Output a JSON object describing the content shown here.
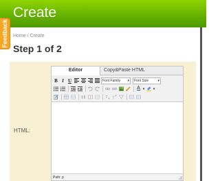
{
  "header": {
    "title": "Create",
    "color": "#66b300"
  },
  "feedback": {
    "label": "Feedback",
    "color": "#f5a623"
  },
  "breadcrumb": {
    "home": "Home",
    "separator": "/",
    "current": "Create"
  },
  "page_title": "Step 1 of 2",
  "form": {
    "html_label": "HTML:"
  },
  "editor": {
    "tabs": [
      {
        "label": "Editor",
        "active": true
      },
      {
        "label": "Copy&Paste HTML",
        "active": false
      }
    ],
    "toolbar": {
      "row1": {
        "bold": "B",
        "italic": "I",
        "underline": "U",
        "font_family": "Font Family",
        "font_size": "Font Size"
      },
      "row2_icons": [
        "bullet-list-icon",
        "numbered-list-icon",
        "outdent-icon",
        "indent-icon",
        "undo-icon",
        "redo-icon",
        "link-icon",
        "unlink-icon",
        "image-icon",
        "cleanup-icon",
        "text-color-icon",
        "highlight-color-icon"
      ],
      "row3_icons": [
        "edit-icon",
        "table-icon",
        "row-icon",
        "column-icon",
        "merge-cells-icon",
        "split-cells-icon",
        "subscript-icon",
        "superscript-icon",
        "source-icon",
        "fullscreen-icon"
      ],
      "text_color_letter": "A"
    },
    "status_path": "Path: p"
  }
}
